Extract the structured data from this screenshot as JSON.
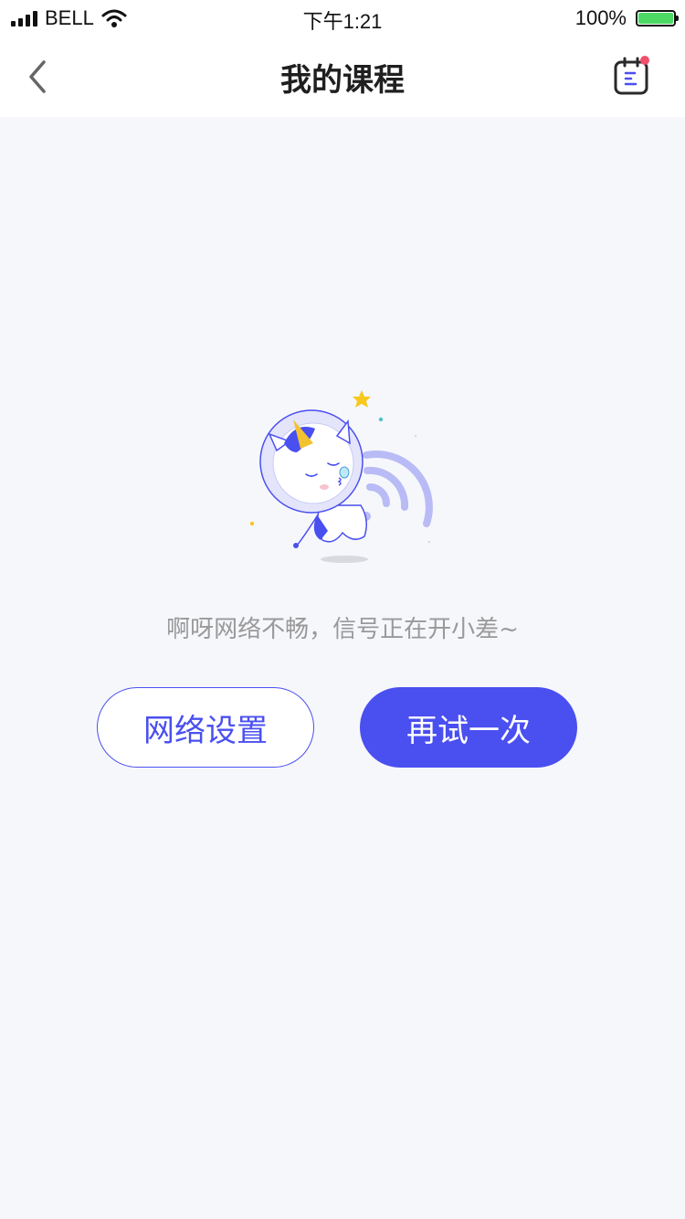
{
  "status_bar": {
    "carrier": "BELL",
    "time": "下午1:21",
    "battery": "100%"
  },
  "header": {
    "title": "我的课程"
  },
  "error": {
    "message": "啊呀网络不畅，信号正在开小差~",
    "network_settings_button": "网络设置",
    "retry_button": "再试一次"
  },
  "colors": {
    "accent": "#4a4ff0",
    "background": "#f6f7fb",
    "notification_dot": "#f0506e",
    "battery": "#4cd964"
  },
  "icons": {
    "back": "chevron-left-icon",
    "schedule": "clipboard-icon",
    "illustration": "astronaut-unicorn-no-signal"
  }
}
